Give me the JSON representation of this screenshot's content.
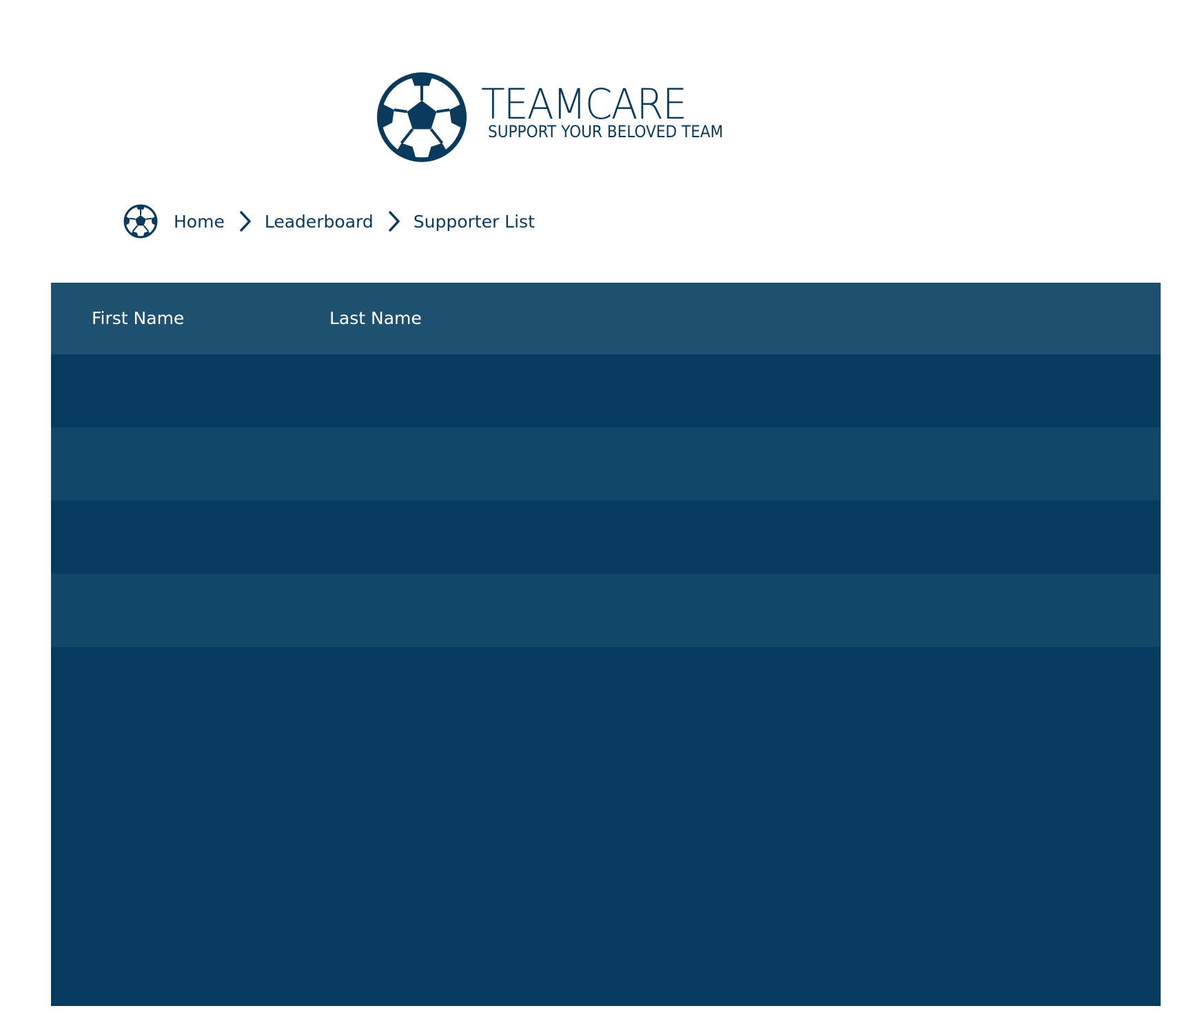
{
  "brand": {
    "name": "TEAMCARE",
    "tagline": "SUPPORT YOUR BELOVED TEAM",
    "logo_icon": "soccer-ball-icon",
    "color": "#0a3a5c"
  },
  "breadcrumb": {
    "home_icon": "soccer-ball-icon",
    "items": [
      {
        "label": "Home"
      },
      {
        "label": "Leaderboard"
      },
      {
        "label": "Supporter List"
      }
    ],
    "separator_icon": "chevron-right-icon"
  },
  "table": {
    "columns": [
      {
        "label": "First Name"
      },
      {
        "label": "Last Name"
      }
    ],
    "rows": [],
    "colors": {
      "header": "#1e5070",
      "row_dark": "#073c60",
      "row_light": "#124867",
      "header_text": "#ffffff"
    }
  }
}
